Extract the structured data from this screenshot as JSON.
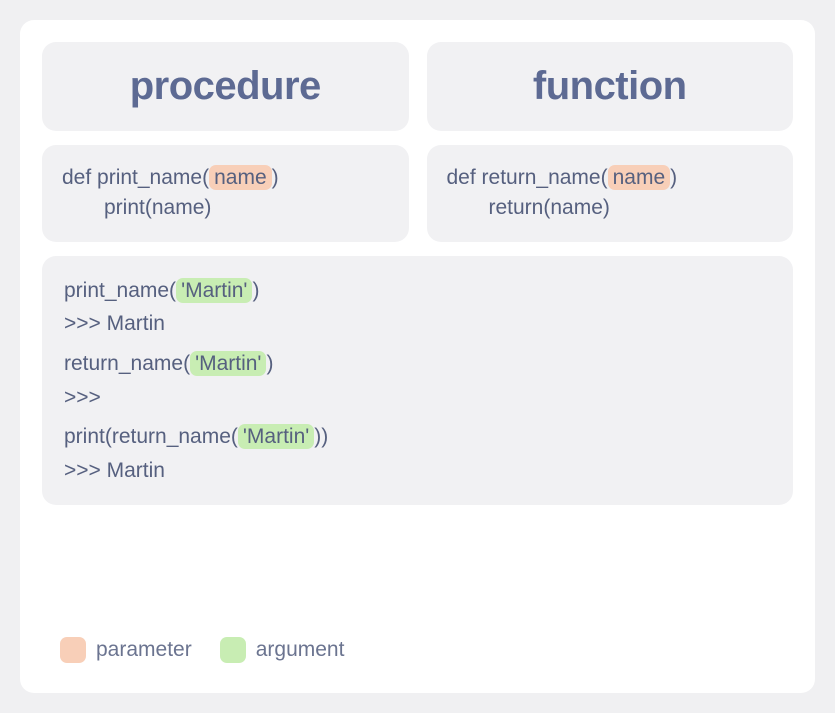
{
  "headers": {
    "procedure": "procedure",
    "function": "function"
  },
  "procedure_def": {
    "prefix": "def print_name(",
    "param": "name",
    "suffix": ")",
    "body": "print(name)"
  },
  "function_def": {
    "prefix": "def return_name(",
    "param": "name",
    "suffix": ")",
    "body": "return(name)"
  },
  "examples": {
    "l1_a": "print_name(",
    "l1_arg": "'Martin'",
    "l1_b": ")",
    "l1_out": ">>> Martin",
    "l2_a": "return_name(",
    "l2_arg": "'Martin'",
    "l2_b": ")",
    "l2_out": ">>>",
    "l3_a": "print(return_name(",
    "l3_arg": "'Martin'",
    "l3_b": "))",
    "l3_out": ">>> Martin"
  },
  "legend": {
    "parameter": "parameter",
    "argument": "argument"
  },
  "colors": {
    "param_highlight": "#f8cfb8",
    "arg_highlight": "#c8edb3"
  }
}
